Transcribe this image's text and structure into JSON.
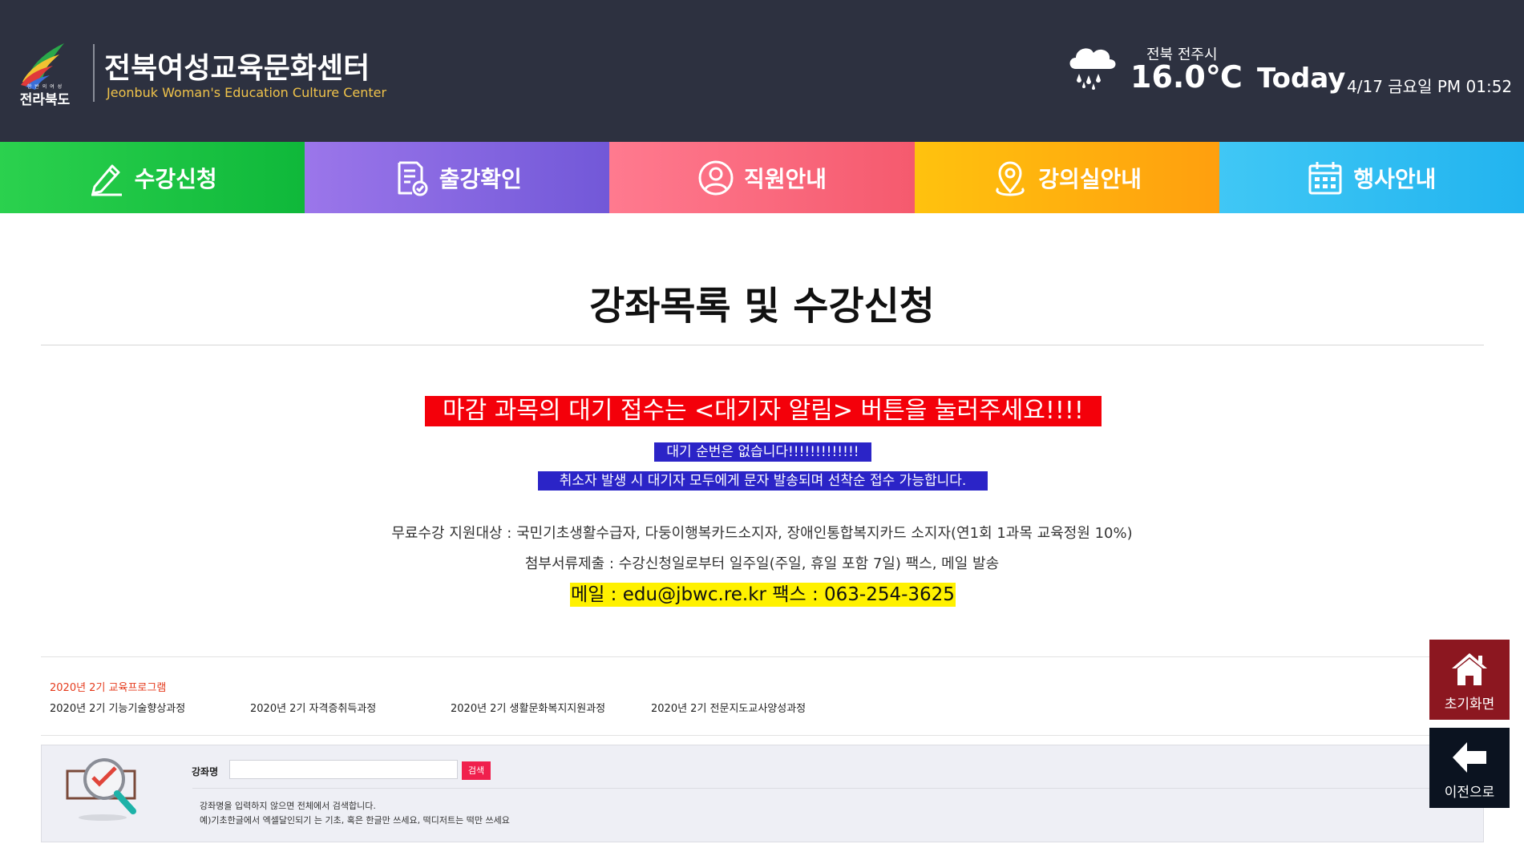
{
  "header": {
    "logo": {
      "icon": "jeonbuk-province-logo",
      "sub_text": "한 반 의 여 성",
      "province_name": "전라북도"
    },
    "site_title": "전북여성교육문화센터",
    "site_subtitle": "Jeonbuk Woman's Education Culture Center",
    "weather": {
      "icon": "rain-cloud-icon",
      "location": "전북 전주시",
      "temperature": "16.0℃"
    },
    "today": {
      "label": "Today",
      "datetime": "4/17 금요일 PM 01:52"
    }
  },
  "nav": {
    "items": [
      {
        "label": "수강신청",
        "icon": "pencil-icon",
        "color": "#1cc644"
      },
      {
        "label": "출강확인",
        "icon": "checklist-icon",
        "color": "#8467e0"
      },
      {
        "label": "직원안내",
        "icon": "person-icon",
        "color": "#f86a7f"
      },
      {
        "label": "강의실안내",
        "icon": "location-pin-icon",
        "color": "#ffb20e"
      },
      {
        "label": "행사안내",
        "icon": "calendar-icon",
        "color": "#31bef2"
      }
    ]
  },
  "main": {
    "title": "강좌목록 및 수강신청",
    "notice_red": "마감 과목의 대기 접수는 <대기자 알림> 버튼을 눌러주세요!!!!",
    "notice_blue_1": "대기 순번은 없습니다!!!!!!!!!!!!!",
    "notice_blue_2": "취소자 발생 시 대기자 모두에게 문자 발송되며 선착순 접수 가능합니다.",
    "info_1": "무료수강 지원대상 : 국민기초생활수급자, 다둥이행복카드소지자, 장애인통합복지카드 소지자(연1회 1과목 교육정원 10%)",
    "info_2": "첨부서류제출 : 수강신청일로부터 일주일(주일, 휴일 포함 7일) 팩스, 메일 발송",
    "contact": "메일 : edu@jbwc.re.kr  팩스 : 063-254-3625"
  },
  "programs": {
    "heading": "2020년 2기 교육프로그램",
    "links": [
      "2020년 2기 기능기술향상과정",
      "2020년 2기 자격증취득과정",
      "2020년 2기 생활문화복지지원과정",
      "2020년 2기 전문지도교사양성과정"
    ]
  },
  "search": {
    "illustration": "magnifier-checklist-icon",
    "label": "강좌명",
    "value": "",
    "placeholder": "",
    "button": "검색",
    "hint_1": "강좌명을 입력하지 않으면 전체에서 검색합니다.",
    "hint_2": "예)기초한글에서 엑셀달인되기 는 기초, 혹은 한글만 쓰세요, 떡디저트는 떡만 쓰세요"
  },
  "side_buttons": {
    "home": {
      "label": "초기화면",
      "icon": "home-icon",
      "color": "#8c1720"
    },
    "back": {
      "label": "이전으로",
      "icon": "arrow-left-icon",
      "color": "#0b1320"
    }
  }
}
